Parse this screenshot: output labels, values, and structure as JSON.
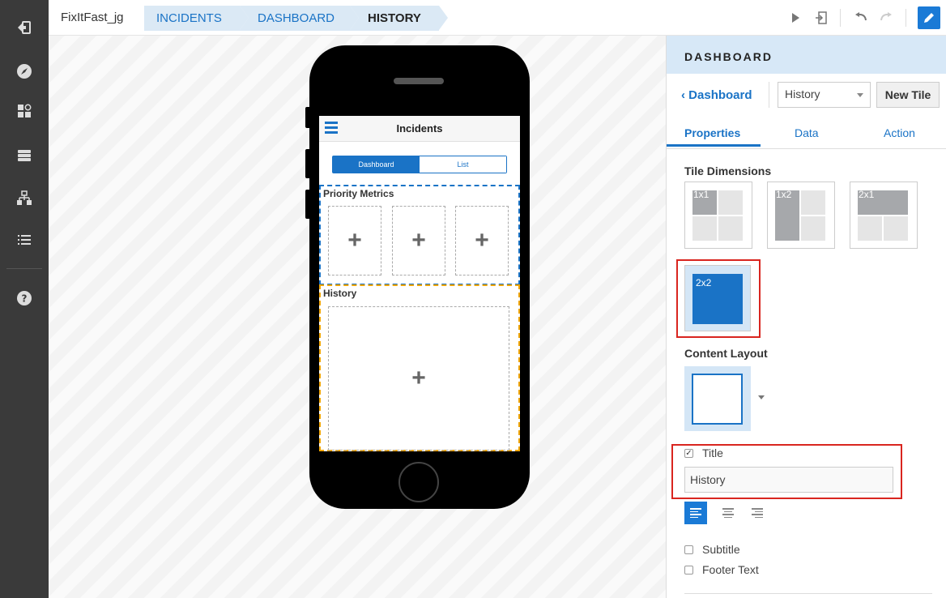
{
  "breadcrumb": {
    "app": "FixItFast_jg",
    "items": [
      "INCIDENTS",
      "DASHBOARD",
      "HISTORY"
    ]
  },
  "phone": {
    "app_title": "Incidents",
    "segments": [
      "Dashboard",
      "List"
    ],
    "sections": [
      {
        "label": "Priority Metrics",
        "tiles": [
          "+",
          "+",
          "+"
        ]
      },
      {
        "label": "History",
        "tiles": [
          "+"
        ]
      }
    ]
  },
  "panel": {
    "header": "DASHBOARD",
    "back_label": "Dashboard",
    "select_value": "History",
    "new_tile_label": "New Tile",
    "tabs": [
      "Properties",
      "Data",
      "Action"
    ],
    "tile_dimensions_label": "Tile Dimensions",
    "dimensions": [
      "1x1",
      "1x2",
      "2x1",
      "2x2"
    ],
    "content_layout_label": "Content Layout",
    "title_checkbox_label": "Title",
    "title_value": "History",
    "subtitle_label": "Subtitle",
    "footer_label": "Footer Text"
  },
  "colors": {
    "accent": "#1a73c6",
    "sidebar": "#3a3a3a",
    "highlight": "#d9251f",
    "history_section": "#f0a500"
  }
}
